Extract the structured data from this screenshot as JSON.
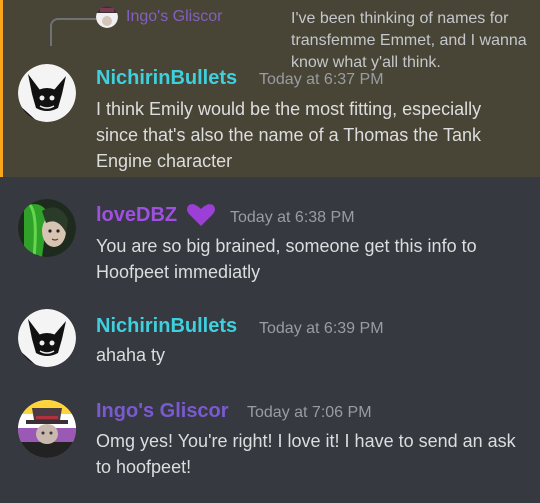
{
  "reply": {
    "author": "Ingo's Gliscor",
    "text": "I've been thinking of names for transfemme Emmet, and I wanna know what y'all think."
  },
  "messages": [
    {
      "author": "NichirinBullets",
      "author_color": "#3ed0de",
      "timestamp": "Today at 6:37 PM",
      "text": "I think Emily would be the most fitting, especially since that's also the name of a Thomas the Tank Engine character"
    },
    {
      "author": "loveDBZ",
      "author_color": "#a050e0",
      "badge_icon": "purple-heart-icon",
      "timestamp": "Today at 6:38 PM",
      "text": "You are so big brained, someone get this info to Hoofpeet immediatly"
    },
    {
      "author": "NichirinBullets",
      "author_color": "#3ed0de",
      "timestamp": "Today at 6:39 PM",
      "text": "ahaha ty"
    },
    {
      "author": "Ingo's Gliscor",
      "author_color": "#7a5ad0",
      "timestamp": "Today at 7:06 PM",
      "text": "Omg yes! You're right! I love it! I have to send an ask to hoofpeet!"
    }
  ]
}
